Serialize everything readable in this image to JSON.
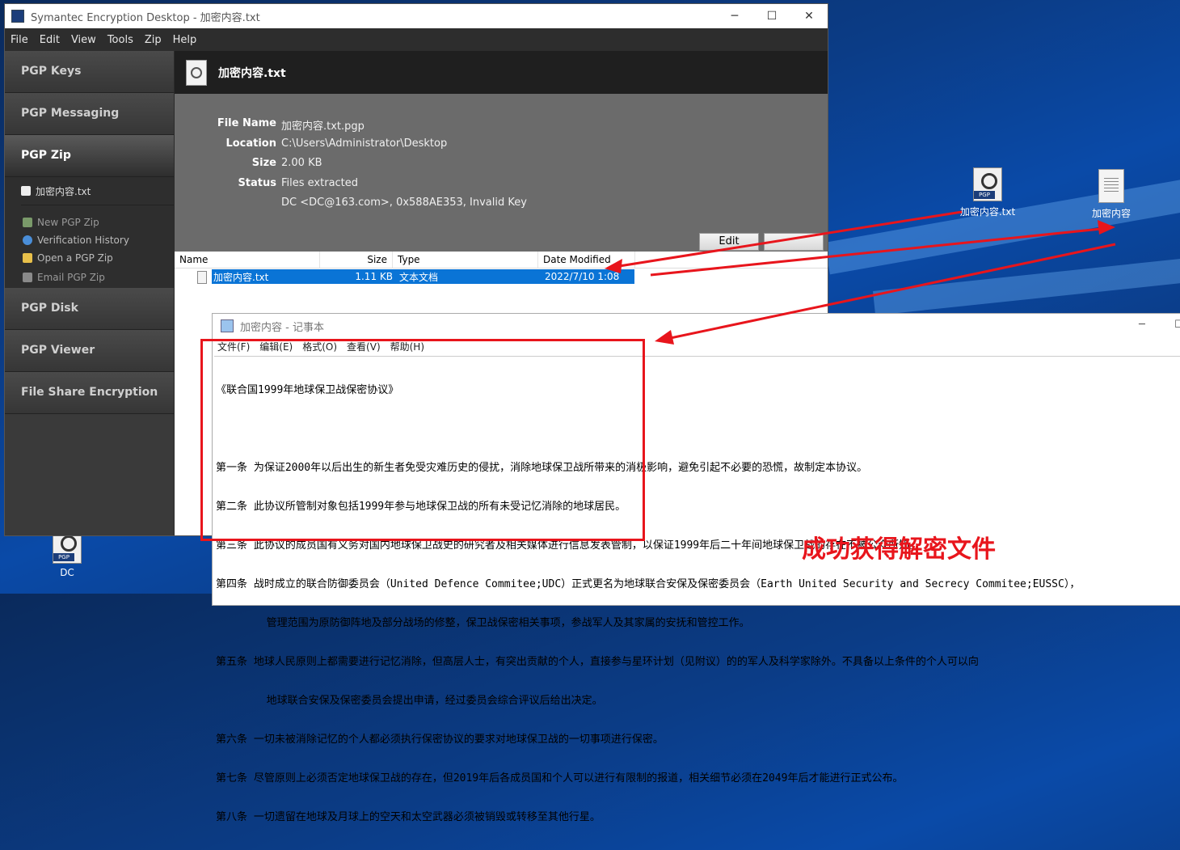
{
  "desktop": {
    "icons": [
      {
        "label": "加密内容.txt"
      },
      {
        "label": "加密内容"
      },
      {
        "label": "DC"
      }
    ],
    "annotation": "成功获得解密文件",
    "annotation_color": "#e8151c"
  },
  "pgp_window": {
    "title": "Symantec Encryption Desktop - 加密内容.txt",
    "menu": [
      "File",
      "Edit",
      "View",
      "Tools",
      "Zip",
      "Help"
    ],
    "nav": {
      "pgp_keys": "PGP Keys",
      "pgp_messaging": "PGP Messaging",
      "pgp_zip": "PGP Zip",
      "current_file": "加密内容.txt",
      "actions": [
        "New PGP Zip",
        "Verification History",
        "Open a PGP Zip",
        "Email PGP Zip"
      ],
      "pgp_disk": "PGP Disk",
      "pgp_viewer": "PGP Viewer",
      "file_share": "File Share Encryption"
    },
    "header_title": "加密内容.txt",
    "props": {
      "file_name_label": "File Name",
      "file_name": "加密内容.txt.pgp",
      "location_label": "Location",
      "location": "C:\\Users\\Administrator\\Desktop",
      "size_label": "Size",
      "size": "2.00 KB",
      "status_label": "Status",
      "status": "Files extracted",
      "signer": "DC <DC@163.com>, 0x588AE353, Invalid Key"
    },
    "edit_button": "Edit",
    "list": {
      "columns": [
        "Name",
        "Size",
        "Type",
        "Date Modified"
      ],
      "rows": [
        {
          "name": "加密内容.txt",
          "size": "1.11 KB",
          "type": "文本文档",
          "date": "2022/7/10 1:08"
        }
      ]
    }
  },
  "notepad": {
    "title": "加密内容 - 记事本",
    "menu": [
      "文件(F)",
      "编辑(E)",
      "格式(O)",
      "查看(V)",
      "帮助(H)"
    ],
    "lines": [
      "《联合国1999年地球保卫战保密协议》",
      "",
      "第一条 为保证2000年以后出生的新生者免受灾难历史的侵扰，消除地球保卫战所带来的消极影响，避免引起不必要的恐慌，故制定本协议。",
      "第二条 此协议所管制对象包括1999年参与地球保卫战的所有未受记忆消除的地球居民。",
      "第三条 此协议的成员国有义务对国内地球保卫战史的研究者及相关媒体进行信息发表管制，以保证1999年后二十年间地球保卫战的存在不被公众所知。",
      "第四条 战时成立的联合防御委员会（United Defence Commitee;UDC）正式更名为地球联合安保及保密委员会（Earth United Security and Secrecy Commitee;EUSSC），",
      "        管理范围为原防御阵地及部分战场的修整，保卫战保密相关事项，参战军人及其家属的安抚和管控工作。",
      "第五条 地球人民原则上都需要进行记忆消除，但高层人士，有突出贡献的个人，直接参与星环计划（见附议）的的军人及科学家除外。不具备以上条件的个人可以向",
      "        地球联合安保及保密委员会提出申请，经过委员会综合评议后给出决定。",
      "第六条 一切未被消除记忆的个人都必须执行保密协议的要求对地球保卫战的一切事项进行保密。",
      "第七条 尽管原则上必须否定地球保卫战的存在，但2019年后各成员国和个人可以进行有限制的报道，相关细节必须在2049年后才能进行正式公布。",
      "第八条 一切遗留在地球及月球上的空天和太空武器必须被销毁或转移至其他行星。"
    ]
  }
}
